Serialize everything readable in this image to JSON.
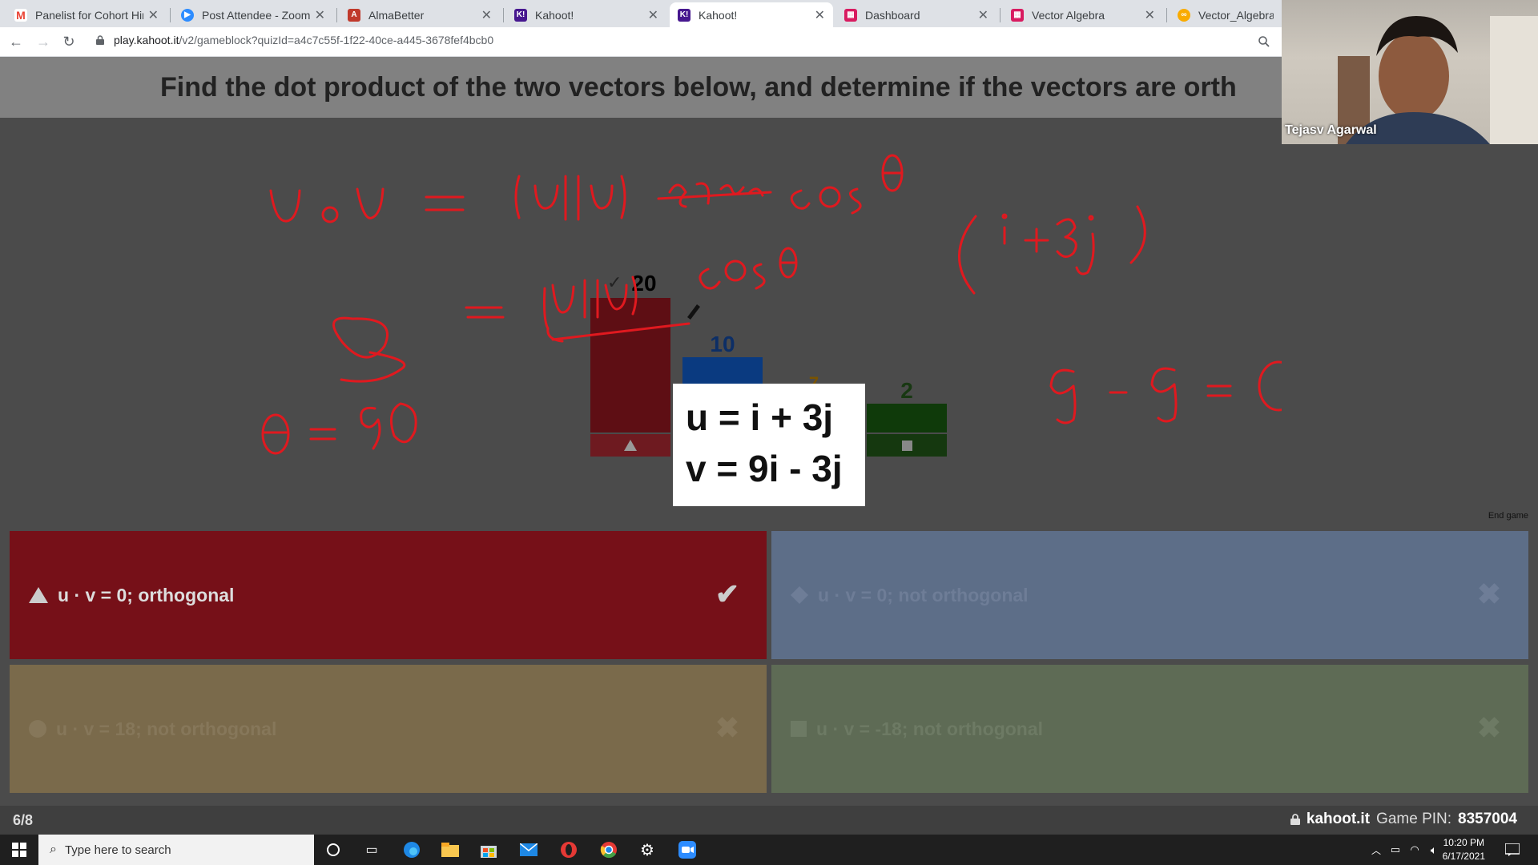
{
  "browser": {
    "tabs": [
      {
        "title": "Panelist for Cohort Himala",
        "icon": "gmail-icon",
        "color": "#ea4335"
      },
      {
        "title": "Post Attendee - Zoom",
        "icon": "zoom-icon",
        "color": "#2d8cff"
      },
      {
        "title": "AlmaBetter",
        "icon": "almabetter-icon",
        "color": "#c0392b"
      },
      {
        "title": "Kahoot!",
        "icon": "kahoot-icon",
        "color": "#46178f"
      },
      {
        "title": "Kahoot!",
        "icon": "kahoot-icon",
        "color": "#46178f",
        "active": true
      },
      {
        "title": "Dashboard",
        "icon": "dashboard-icon",
        "color": "#d81b60"
      },
      {
        "title": "Vector Algebra",
        "icon": "dashboard-icon",
        "color": "#d81b60"
      },
      {
        "title": "Vector_Algebra - Goo",
        "icon": "colab-icon",
        "color": "#f9ab00"
      }
    ],
    "url_host": "play.kahoot.it",
    "url_path": "/v2/gameblock?quizId=a4c7c55f-1f22-40ce-a445-3678fef4bcb0"
  },
  "question": "Find the dot product of the two vectors below, and determine if the vectors are orth",
  "results": {
    "bars": [
      {
        "value": "20",
        "check": "✓",
        "color": "#5e0e14",
        "label_color": "#6e1a20",
        "shape": "triangle",
        "fraction": 1.0
      },
      {
        "value": "10",
        "color": "#0a3a80",
        "label_color": "#16478f",
        "shape": "diamond",
        "fraction": 0.5
      },
      {
        "value": "7",
        "color": "#7a5300",
        "label_color": "#7a5800",
        "shape": "circle",
        "fraction": 0.35
      },
      {
        "value": "2",
        "color": "#0f3a0a",
        "label_color": "#15380f",
        "shape": "square",
        "fraction": 0.1
      }
    ]
  },
  "popup": {
    "line1": "u = i + 3j",
    "line2": "v = 9i - 3j"
  },
  "end_game": "End game",
  "answers": [
    {
      "text": "u · v = 0; orthogonal",
      "shape": "triangle",
      "mark": "✔",
      "color": "#761018",
      "correct": true
    },
    {
      "text": "u · v = 0; not orthogonal",
      "shape": "diamond",
      "mark": "✖",
      "color": "#5d6e88",
      "correct": false
    },
    {
      "text": "u · v = 18; not orthogonal",
      "shape": "circle",
      "mark": "✖",
      "color": "#7a6a4b",
      "correct": false
    },
    {
      "text": "u · v = -18; not orthogonal",
      "shape": "square",
      "mark": "✖",
      "color": "#5e6b55",
      "correct": false
    }
  ],
  "footer": {
    "progress": "6/8",
    "site": "kahoot.it",
    "pin_label": "Game PIN:",
    "pin": "8357004"
  },
  "webcam": {
    "name": "Tejasv Agarwal"
  },
  "annotations": {
    "ink_color": "#e0191f"
  },
  "taskbar": {
    "search_placeholder": "Type here to search",
    "time": "10:20 PM",
    "date": "6/17/2021"
  }
}
